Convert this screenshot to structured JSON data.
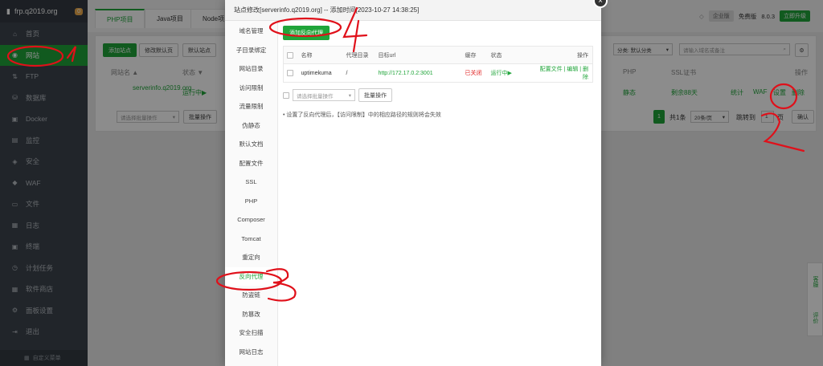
{
  "sidebar": {
    "brand": "frp.q2019.org",
    "badge": "0",
    "items": [
      {
        "label": "首页",
        "icon": "home-icon",
        "glyph": "⌂"
      },
      {
        "label": "网站",
        "icon": "globe-icon",
        "glyph": "◉",
        "active": true
      },
      {
        "label": "FTP",
        "icon": "ftp-icon",
        "glyph": "⇅"
      },
      {
        "label": "数据库",
        "icon": "database-icon",
        "glyph": "⛁"
      },
      {
        "label": "Docker",
        "icon": "docker-icon",
        "glyph": "▣"
      },
      {
        "label": "监控",
        "icon": "monitor-icon",
        "glyph": "▤"
      },
      {
        "label": "安全",
        "icon": "shield-icon",
        "glyph": "◈"
      },
      {
        "label": "WAF",
        "icon": "waf-icon",
        "glyph": "◆"
      },
      {
        "label": "文件",
        "icon": "folder-icon",
        "glyph": "▭"
      },
      {
        "label": "日志",
        "icon": "log-icon",
        "glyph": "▦"
      },
      {
        "label": "终端",
        "icon": "terminal-icon",
        "glyph": "▣"
      },
      {
        "label": "计划任务",
        "icon": "clock-icon",
        "glyph": "◷"
      },
      {
        "label": "软件商店",
        "icon": "store-icon",
        "glyph": "▦"
      },
      {
        "label": "面板设置",
        "icon": "settings-icon",
        "glyph": "⚙"
      },
      {
        "label": "退出",
        "icon": "logout-icon",
        "glyph": "⇥"
      }
    ],
    "custom_menu": "自定义菜单"
  },
  "topbar": {
    "tabs": [
      "PHP项目",
      "Java项目",
      "Node项"
    ],
    "plan": "企业版",
    "free_label": "免费版",
    "version": "8.0.3",
    "upgrade": "立即升级"
  },
  "site_list": {
    "add_site": "添加站点",
    "modify_default": "修改默认页",
    "default_site": "默认站点",
    "col_name": "网站名 ▲",
    "col_status": "状态 ▼",
    "site_name": "serverinfo.q2019.org",
    "site_status": "运行中▶",
    "bulk_placeholder": "请选择批量操作",
    "bulk_btn": "批量操作",
    "category": "分类: 默认分类",
    "search_placeholder": "请输入域名或备注",
    "col_php": "PHP",
    "col_ssl": "SSL证书",
    "col_ops": "操作",
    "php_value": "静态",
    "ssl_value": "剩余88天",
    "op_stats": "统计",
    "op_waf": "WAF",
    "op_settings": "设置",
    "op_delete": "删除",
    "page_num": "1",
    "total": "共1条",
    "per_page": "20条/页",
    "goto_label": "跳转到",
    "goto_value": "1",
    "goto_unit": "页",
    "confirm": "确认"
  },
  "modal": {
    "title": "站点修改[serverinfo.q2019.org] -- 添加时间[2023-10-27 14:38:25]",
    "close": "×",
    "nav": [
      "域名管理",
      "子目录绑定",
      "网站目录",
      "访问限制",
      "流量限制",
      "伪静态",
      "默认文档",
      "配置文件",
      "SSL",
      "PHP",
      "Composer",
      "Tomcat",
      "重定向",
      "反向代理",
      "防盗链",
      "防篡改",
      "安全扫描",
      "网站日志"
    ],
    "active_nav": "反向代理",
    "add_proxy": "添加反向代理",
    "headers": [
      "名称",
      "代理目录",
      "目标url",
      "缓存",
      "状态",
      "操作"
    ],
    "rows": [
      {
        "name": "uptimekuma",
        "dir": "/",
        "url": "http://172.17.0.2:3001",
        "cache": "已关闭",
        "status": "运行中▶",
        "ops": "配置文件 | 编辑 | 删除"
      }
    ],
    "bulk_placeholder": "请选择批量操作",
    "bulk_btn": "批量操作",
    "note": "• 设置了反向代理后，【访问限制】中的相应路径的规则将会失效"
  },
  "float_panel": {
    "service": "客服",
    "review": "评价"
  },
  "annotations": [
    "1",
    "2",
    "3",
    "4"
  ],
  "colors": {
    "brand_green": "#20a53a",
    "sidebar_bg": "#3c444d",
    "annotation_red": "#e0101a"
  }
}
